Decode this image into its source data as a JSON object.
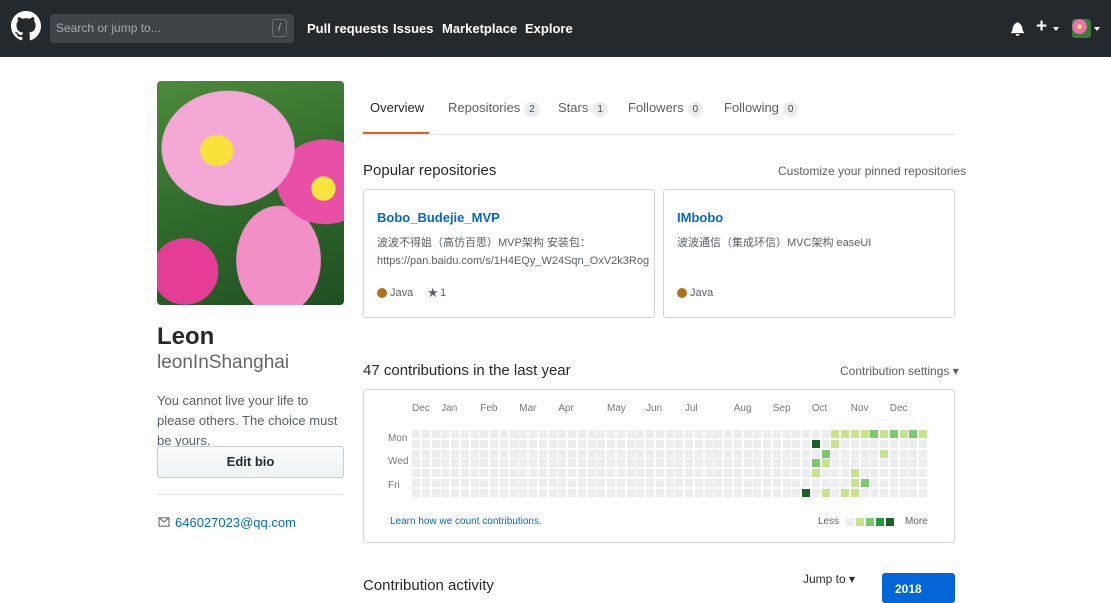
{
  "header": {
    "search_placeholder": "Search or jump to...",
    "search_shortcut": "/",
    "nav": [
      "Pull requests",
      "Issues",
      "Marketplace",
      "Explore"
    ],
    "plus": "+"
  },
  "profile": {
    "name": "Leon",
    "login": "leonInShanghai",
    "bio": "You cannot live your life to please others. The choice must be yours.",
    "edit_bio_label": "Edit bio",
    "email": "646027023@qq.com"
  },
  "tabs": [
    {
      "label": "Overview",
      "count": ""
    },
    {
      "label": "Repositories",
      "count": "2"
    },
    {
      "label": "Stars",
      "count": "1"
    },
    {
      "label": "Followers",
      "count": "0"
    },
    {
      "label": "Following",
      "count": "0"
    }
  ],
  "popular": {
    "title": "Popular repositories",
    "customize_label": "Customize your pinned repositories",
    "repos": [
      {
        "name": "Bobo_Budejie_MVP",
        "desc": "波波不得姐（高仿百思）MVP架构 安装包：https://pan.baidu.com/s/1H4EQy_W24Sqn_OxV2k3Rog",
        "language": "Java",
        "language_color": "#b07219",
        "stars": "1"
      },
      {
        "name": "IMbobo",
        "desc": "波波通信（集成环信）MVC架构 easeUI",
        "language": "Java",
        "language_color": "#b07219",
        "stars": ""
      }
    ]
  },
  "contributions": {
    "title": "47 contributions in the last year",
    "settings_label": "Contribution settings",
    "months": [
      "Dec",
      "Jan",
      "Feb",
      "Mar",
      "Apr",
      "May",
      "Jun",
      "Jul",
      "Aug",
      "Sep",
      "Oct",
      "Nov",
      "Dec"
    ],
    "days": [
      "Mon",
      "Wed",
      "Fri"
    ],
    "learn_link": "Learn how we count contributions.",
    "legend_less": "Less",
    "legend_more": "More",
    "level_colors": [
      "#ebedf0",
      "#c6e48b",
      "#7bc96f",
      "#239a3b",
      "#196127"
    ],
    "active_cells": [
      {
        "week": 40,
        "day": 6,
        "level": 4
      },
      {
        "week": 41,
        "day": 1,
        "level": 4
      },
      {
        "week": 41,
        "day": 3,
        "level": 2
      },
      {
        "week": 41,
        "day": 4,
        "level": 1
      },
      {
        "week": 42,
        "day": 2,
        "level": 2
      },
      {
        "week": 42,
        "day": 3,
        "level": 1
      },
      {
        "week": 42,
        "day": 6,
        "level": 1
      },
      {
        "week": 43,
        "day": 0,
        "level": 1
      },
      {
        "week": 43,
        "day": 1,
        "level": 1
      },
      {
        "week": 44,
        "day": 0,
        "level": 1
      },
      {
        "week": 44,
        "day": 6,
        "level": 1
      },
      {
        "week": 45,
        "day": 0,
        "level": 1
      },
      {
        "week": 45,
        "day": 4,
        "level": 1
      },
      {
        "week": 45,
        "day": 5,
        "level": 1
      },
      {
        "week": 45,
        "day": 6,
        "level": 1
      },
      {
        "week": 46,
        "day": 0,
        "level": 1
      },
      {
        "week": 46,
        "day": 5,
        "level": 2
      },
      {
        "week": 47,
        "day": 0,
        "level": 2
      },
      {
        "week": 48,
        "day": 0,
        "level": 1
      },
      {
        "week": 48,
        "day": 2,
        "level": 1
      },
      {
        "week": 49,
        "day": 0,
        "level": 2
      },
      {
        "week": 50,
        "day": 0,
        "level": 1
      },
      {
        "week": 51,
        "day": 0,
        "level": 2
      },
      {
        "week": 52,
        "day": 0,
        "level": 1
      }
    ]
  },
  "activity": {
    "title": "Contribution activity",
    "jump_label": "Jump to",
    "year": "2018"
  }
}
